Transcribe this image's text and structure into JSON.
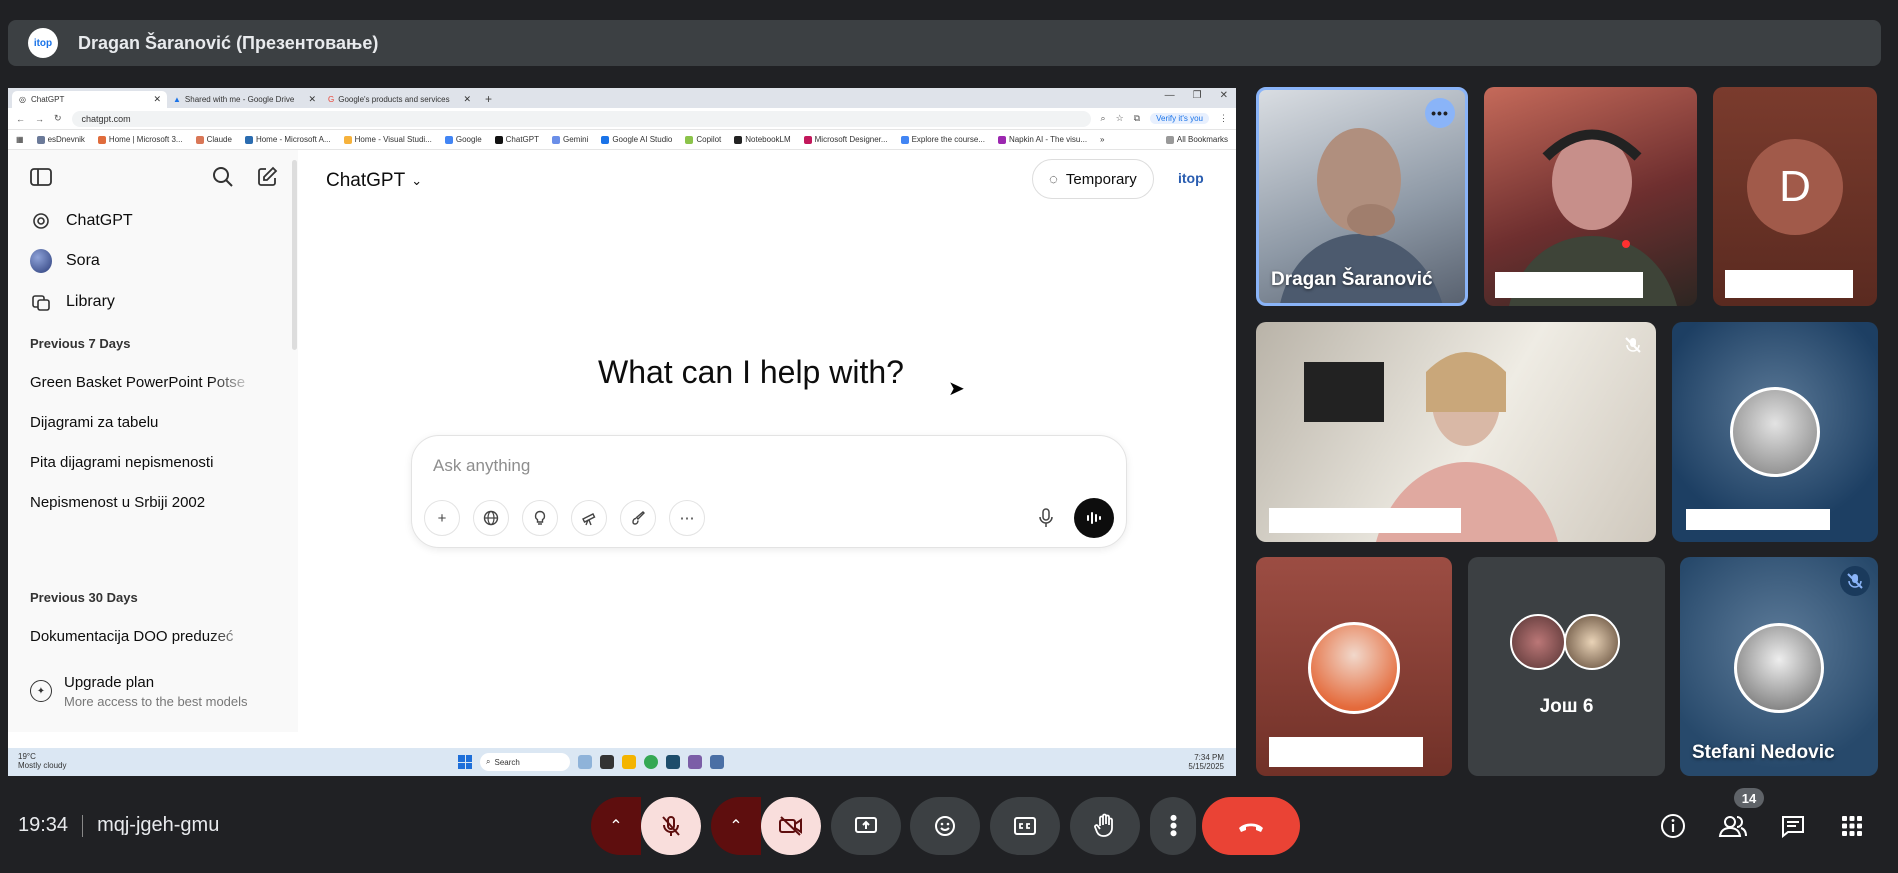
{
  "presenter_bar": {
    "logo_text": "itop",
    "title": "Dragan Šaranović (Презентовање)"
  },
  "browser": {
    "tabs": [
      {
        "label": "ChatGPT"
      },
      {
        "label": "Shared with me - Google Drive"
      },
      {
        "label": "Google's products and services"
      }
    ],
    "url": "chatgpt.com",
    "verify_label": "Verify it's you",
    "bookmarks": [
      "esDnevnik",
      "Home | Microsoft 3...",
      "Claude",
      "Home - Microsoft A...",
      "Home - Visual Studi...",
      "Google",
      "ChatGPT",
      "Gemini",
      "Google AI Studio",
      "Copilot",
      "NotebookLM",
      "Microsoft Designer...",
      "Explore the course...",
      "Napkin AI - The visu..."
    ],
    "all_bookmarks": "All Bookmarks"
  },
  "chatgpt": {
    "sidebar": {
      "items": [
        {
          "label": "ChatGPT",
          "icon": "openai-icon"
        },
        {
          "label": "Sora",
          "icon": "sora-icon"
        },
        {
          "label": "Library",
          "icon": "library-icon"
        }
      ],
      "section_7": "Previous 7 Days",
      "chats_7": [
        "Green Basket PowerPoint Potse",
        "Dijagrami za tabelu",
        "Pita dijagrami nepismenosti",
        "Nepismenost u Srbiji 2002"
      ],
      "section_30": "Previous 30 Days",
      "chats_30": [
        "Dokumentacija DOO preduzeć"
      ],
      "upgrade_title": "Upgrade plan",
      "upgrade_sub": "More access to the best models"
    },
    "model_label": "ChatGPT",
    "temporary_label": "Temporary",
    "logo_text": "itop",
    "greeting": "What can I help with?",
    "composer_placeholder": "Ask anything"
  },
  "taskbar": {
    "weather_temp": "19°C",
    "weather_desc": "Mostly cloudy",
    "search_label": "Search",
    "time": "7:34 PM",
    "date": "5/15/2025"
  },
  "participants": {
    "p1_name": "Dragan Šaranović",
    "p3_initial": "D",
    "others_label": "Још 6",
    "p9_name": "Stefani Nedovic"
  },
  "meeting": {
    "time": "19:34",
    "code": "mqj-jgeh-gmu",
    "participant_count": "14"
  },
  "colors": {
    "meet_bg": "#202124",
    "hangup": "#ea4335",
    "muted_bg": "#f9dedc",
    "accent": "#8ab4f8"
  }
}
